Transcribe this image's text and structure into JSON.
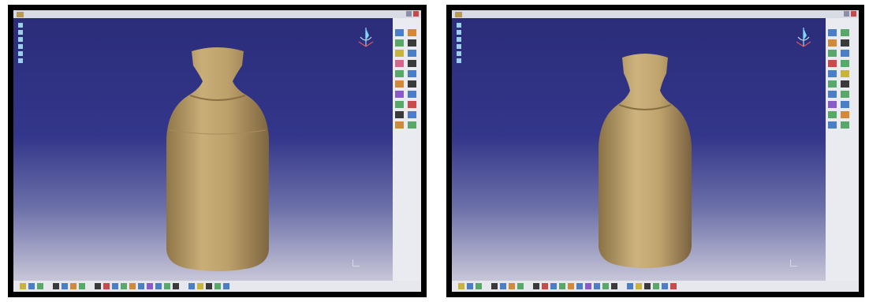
{
  "screens": [
    {
      "id": "left",
      "title_bar": {
        "app_title": "",
        "menu": [
          "",
          "",
          "",
          "",
          "",
          "",
          ""
        ]
      },
      "tree": [
        "",
        "",
        "",
        "",
        "",
        ""
      ],
      "model": "bottle",
      "colors": {
        "viewport_top": "#2b2d7a",
        "viewport_bottom": "#c7c6d8",
        "model": "#b59a64"
      }
    },
    {
      "id": "right",
      "title_bar": {
        "app_title": "",
        "menu": [
          "",
          "",
          "",
          "",
          "",
          "",
          ""
        ]
      },
      "tree": [
        "",
        "",
        "",
        "",
        "",
        ""
      ],
      "model": "bottle",
      "colors": {
        "viewport_top": "#2b2d7a",
        "viewport_bottom": "#c7c6d8",
        "model": "#b8a06c"
      }
    }
  ],
  "icons": {
    "menubar_logo": "catia-logo-icon",
    "compass": "compass-icon",
    "model": "bottle-icon",
    "toolbar": "tool-icon"
  }
}
